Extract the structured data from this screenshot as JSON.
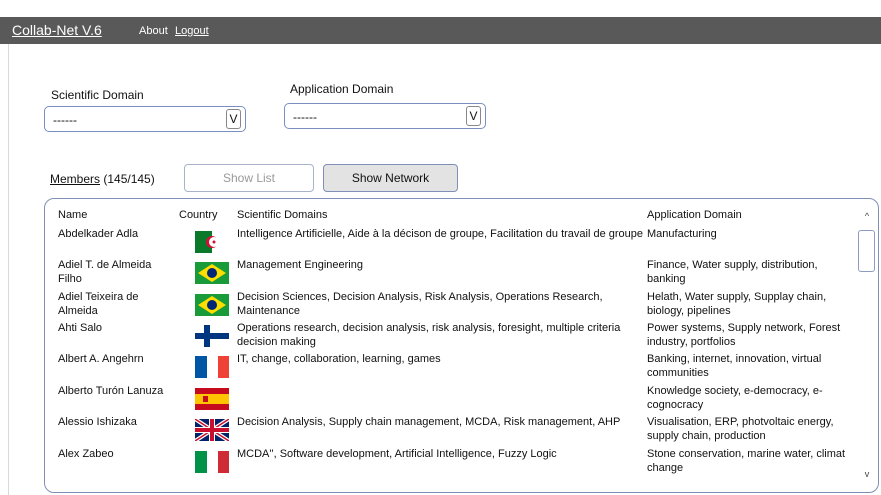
{
  "header": {
    "title": "Collab-Net V.6",
    "about": "About",
    "logout": "Logout"
  },
  "filters": {
    "scientific_label": "Scientific Domain",
    "scientific_value": "------",
    "application_label": "Application Domain",
    "application_value": "------",
    "dropdown_glyph": "V"
  },
  "members": {
    "label": "Members",
    "count": "(145/145)",
    "show_list": "Show List",
    "show_network": "Show Network"
  },
  "table": {
    "columns": [
      "Name",
      "Country",
      "Scientific Domains",
      "Application Domain"
    ],
    "rows": [
      {
        "name": "Abdelkader Adla",
        "flag": "algeria-flag",
        "scientific": "Intelligence Artificielle, Aide à la décison de groupe, Facilitation du travail de groupe",
        "application": "Manufacturing"
      },
      {
        "name": "Adiel T. de Almeida Filho",
        "flag": "brazil-flag",
        "scientific": "Management Engineering",
        "application": "Finance, Water supply, distribution, banking"
      },
      {
        "name": "Adiel Teixeira de Almeida",
        "flag": "brazil-flag",
        "scientific": "Decision Sciences, Decision Analysis, Risk Analysis, Operations Research, Maintenance",
        "application": "Helath, Water supply, Supplay chain, biology, pipelines"
      },
      {
        "name": "Ahti Salo",
        "flag": "finland-flag",
        "scientific": "Operations research, decision analysis, risk analysis, foresight, multiple criteria decision making",
        "application": "Power systems, Supply network, Forest industry, portfolios"
      },
      {
        "name": "Albert A. Angehrn",
        "flag": "france-flag",
        "scientific": "IT, change, collaboration, learning, games",
        "application": "Banking, internet, innovation, virtual communities"
      },
      {
        "name": "Alberto Turón Lanuza",
        "flag": "spain-flag",
        "scientific": "",
        "application": "Knowledge society, e-democracy, e-cognocracy"
      },
      {
        "name": "Alessio Ishizaka",
        "flag": "uk-flag",
        "scientific": "Decision Analysis, Supply chain management, MCDA, Risk management, AHP",
        "application": "Visualisation, ERP, photvoltaic energy, supply chain, production"
      },
      {
        "name": "Alex Zabeo",
        "flag": "italy-flag",
        "scientific": "MCDA'', Software development, Artificial Intelligence, Fuzzy Logic",
        "application": "Stone conservation, marine water, climat change"
      }
    ]
  },
  "scrollbar": {
    "up": "^",
    "down": "v"
  },
  "colors": {
    "topbar": "#595959",
    "border": "#7f8fb7"
  }
}
